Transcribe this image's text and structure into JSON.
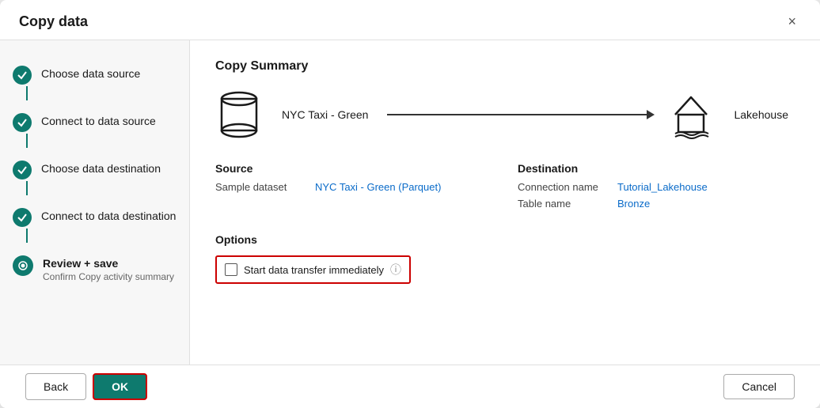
{
  "modal": {
    "title": "Copy data",
    "close_label": "×"
  },
  "sidebar": {
    "steps": [
      {
        "id": "choose-source",
        "label": "Choose data source",
        "sublabel": "",
        "state": "completed",
        "active": false
      },
      {
        "id": "connect-source",
        "label": "Connect to data source",
        "sublabel": "",
        "state": "completed",
        "active": false
      },
      {
        "id": "choose-destination",
        "label": "Choose data destination",
        "sublabel": "",
        "state": "completed",
        "active": false
      },
      {
        "id": "connect-destination",
        "label": "Connect to data destination",
        "sublabel": "",
        "state": "completed",
        "active": false
      },
      {
        "id": "review-save",
        "label": "Review + save",
        "sublabel": "Confirm Copy activity summary",
        "state": "active",
        "active": true
      }
    ]
  },
  "main": {
    "section_title": "Copy Summary",
    "flow": {
      "source_label": "NYC Taxi - Green",
      "dest_label": "Lakehouse"
    },
    "source": {
      "title": "Source",
      "items": [
        {
          "key": "Sample dataset",
          "value": "NYC Taxi - Green (Parquet)"
        }
      ]
    },
    "destination": {
      "title": "Destination",
      "items": [
        {
          "key": "Connection name",
          "value": "Tutorial_Lakehouse"
        },
        {
          "key": "Table name",
          "value": "Bronze"
        }
      ]
    },
    "options": {
      "title": "Options",
      "checkbox_label": "Start data transfer immediately",
      "info_icon": "ⓘ"
    }
  },
  "footer": {
    "back_label": "Back",
    "ok_label": "OK",
    "cancel_label": "Cancel"
  }
}
